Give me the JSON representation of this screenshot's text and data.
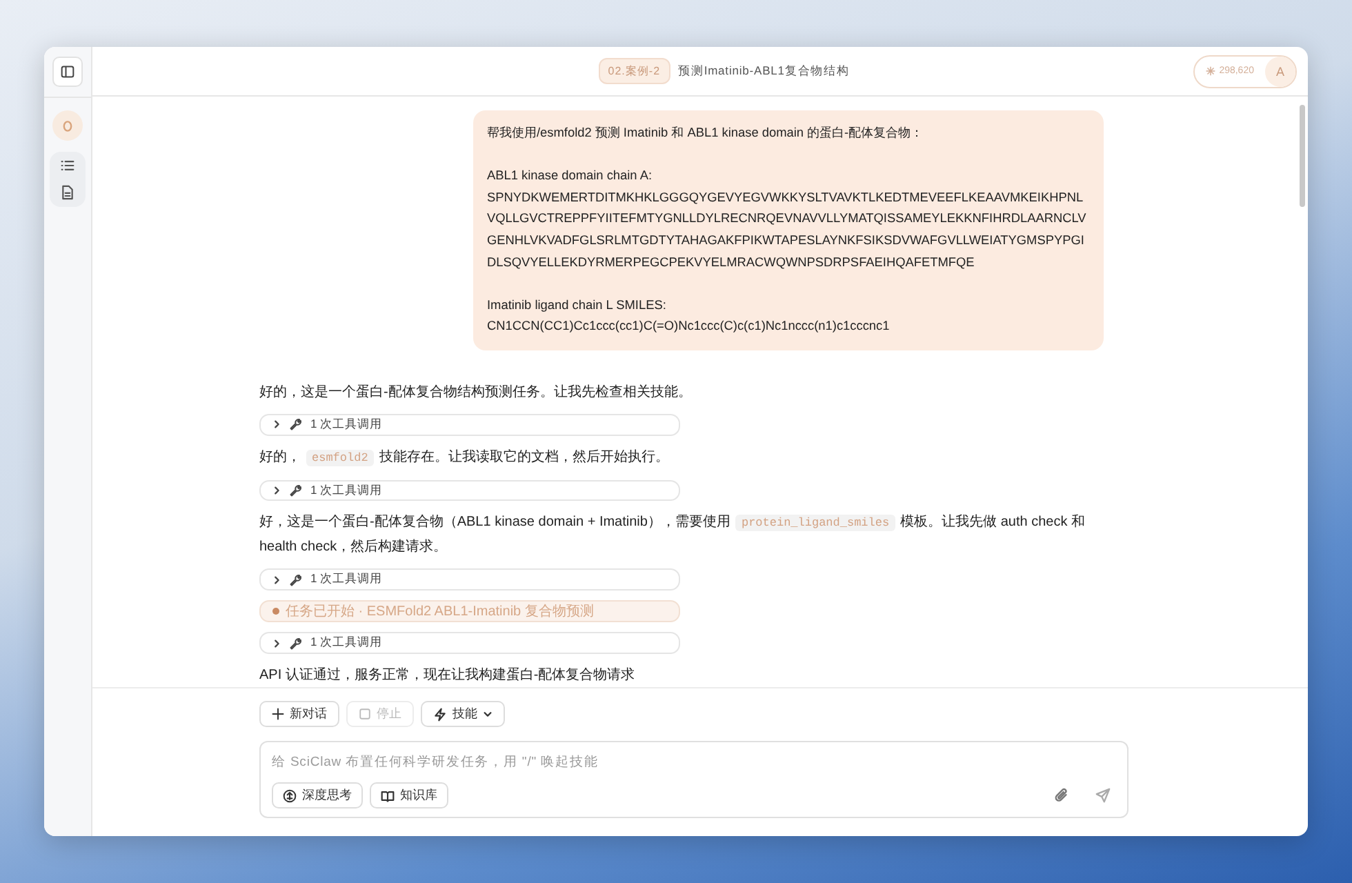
{
  "header": {
    "badge": "02.案例-2",
    "title": "预测Imatinib-ABL1复合物结构",
    "tokens": "298,620",
    "avatar": "A"
  },
  "messages": [
    {
      "kind": "user",
      "paragraphs": [
        [
          "帮我使用/esmfold2 预测 Imatinib 和 ABL1 kinase domain 的蛋白-配体复合物："
        ],
        [
          "ABL1 kinase domain chain A:",
          "SPNYDKWEMERTDITMKHKLGGGQYGEVYEGVWKKYSLTVAVKTLKEDTMEVEEFLKEAAVMKEIKHPNL",
          "VQLLGVCTREPPFYIITEFMTYGNLLDYLRECNRQEVNAVVLLYMATQISSAMEYLEKKNFIHRDLAARNCLV",
          "GENHLVKVADFGLSRLMTGDTYTAHAGAKFPIKWTAPESLAYNKFSIKSDVWAFGVLLWEIATYGMSPYPGI",
          "DLSQVYELLEKDYRMERPEGCPEKVYELMRACWQWNPSDRPSFAEIHQAFETMFQE"
        ],
        [
          "Imatinib ligand chain L SMILES:",
          "CN1CCN(CC1)Cc1ccc(cc1)C(=O)Nc1ccc(C)c(c1)Nc1nccc(n1)c1cccnc1"
        ]
      ]
    },
    {
      "kind": "text",
      "parts": [
        {
          "kind": "plain",
          "text": "好的，这是一个蛋白-配体复合物结构预测任务。让我先检查相关技能。"
        }
      ]
    },
    {
      "kind": "tool",
      "label": "1 次工具调用",
      "expanded": false
    },
    {
      "kind": "text",
      "parts": [
        {
          "kind": "plain",
          "text": "好的，"
        },
        {
          "kind": "code",
          "text": "esmfold2"
        },
        {
          "kind": "plain",
          "text": "技能存在。让我读取它的文档，然后开始执行。"
        }
      ]
    },
    {
      "kind": "tool",
      "label": "1 次工具调用",
      "expanded": false
    },
    {
      "kind": "text",
      "parts": [
        {
          "kind": "plain",
          "text": "好，这是一个蛋白-配体复合物（ABL1 kinase domain + Imatinib），需要使用"
        },
        {
          "kind": "code",
          "text": "protein_ligand_smiles"
        },
        {
          "kind": "plain",
          "text": "模板。让我先做 auth check 和 health check，然后构建请求。"
        }
      ]
    },
    {
      "kind": "tool",
      "label": "1 次工具调用",
      "expanded": false
    },
    {
      "kind": "notice",
      "text": "任务已开始 · ESMFold2 ABL1-Imatinib 复合物预测"
    },
    {
      "kind": "tool",
      "label": "1 次工具调用",
      "expanded": false
    },
    {
      "kind": "text",
      "parts": [
        {
          "kind": "plain",
          "text": "API 认证通过，服务正常，现在让我构建蛋白-配体复合物请求"
        }
      ]
    }
  ],
  "actions": [
    {
      "kind": "new",
      "label": "新对话",
      "disabled": false
    },
    {
      "kind": "stop",
      "label": "停止",
      "disabled": true
    },
    {
      "kind": "skills",
      "label": "技能",
      "disabled": false
    }
  ],
  "composer": {
    "placeholder": "给 SciClaw 布置任何科学研发任务，用 \"/\" 唤起技能",
    "tools": [
      {
        "kind": "think",
        "label": "深度思考"
      },
      {
        "kind": "kb",
        "label": "知识库"
      }
    ]
  }
}
